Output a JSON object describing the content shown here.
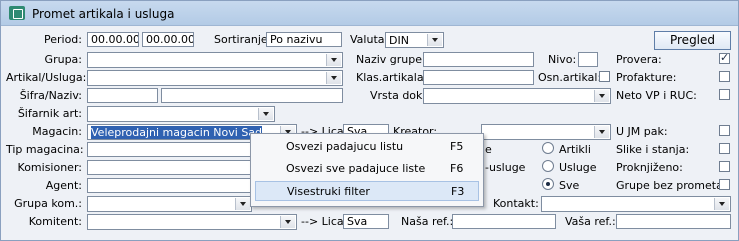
{
  "window": {
    "title": "Promet artikala i usluga"
  },
  "form": {
    "period_label": "Period:",
    "period_from": "00.00.00",
    "period_to": "00.00.00",
    "sort_label": "Sortiranje:",
    "sort_value": "Po nazivu",
    "currency_label": "Valuta:",
    "currency_value": "DIN",
    "refresh_button": "Pregled",
    "group_label": "Grupa:",
    "group_name_label": "Naziv grupe:",
    "level_label": "Nivo:",
    "check_label": "Provera:",
    "article_label": "Artikal/Usluga:",
    "class_article_label": "Klas.artikala:",
    "base_article_label": "Osn.artikal:",
    "proforma_label": "Profakture:",
    "code_label": "Šifra/Naziv:",
    "doc_type_label": "Vrsta dok:",
    "neto_label": "Neto VP i RUC:",
    "catalog_label": "Šifarnik art:",
    "warehouse_label": "Magacin:",
    "warehouse_value": "Veleprodajni magacin Novi Sad",
    "arrow_lica_label": "--> Lica:",
    "lica_value": "Sva",
    "creator_label": "Kreator:",
    "jm_label": "U JM pak:",
    "tip_label": "Tip magacina:",
    "e_label": "e",
    "slike_label": "Slike i stanja:",
    "komis_label": "Komisioner:",
    "usluge_label": "-usluge",
    "proknj_label": "Proknjiženo:",
    "agent_label": "Agent:",
    "bez_label": "Grupe bez prometa:",
    "grupa_kom_label": "Grupa kom.:",
    "kontakt_label": "Kontakt:",
    "komitent_label": "Komitent:",
    "lica2_value": "Sva",
    "nasa_ref_label": "Naša ref.:",
    "vasa_ref_label": "Vaša ref.:"
  },
  "radios": {
    "artikli": "Artikli",
    "usluge": "Usluge",
    "sve": "Sve"
  },
  "menu": {
    "items": [
      {
        "label": "Osvezi padajucu listu",
        "key": "F5"
      },
      {
        "label": "Osvezi sve padajuce liste",
        "key": "F6"
      },
      {
        "label": "Visestruki filter",
        "key": "F3"
      }
    ]
  },
  "colors": {
    "selection": "#2f61b1",
    "menu_highlight": "#dce8f7"
  }
}
